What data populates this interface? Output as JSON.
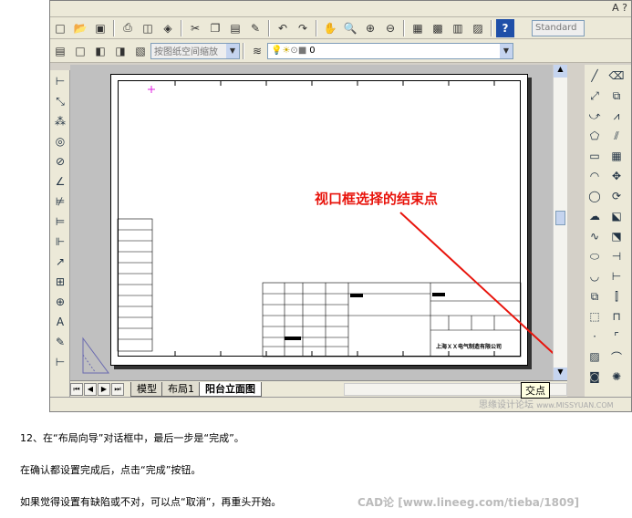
{
  "toolbar": {
    "layer_combo": "按图纸空间缩放",
    "layer_value": "0",
    "style_combo": "Standard"
  },
  "annotation": {
    "text": "视口框选择的结束点"
  },
  "tabs": [
    "模型",
    "布局1",
    "阳台立面图"
  ],
  "status": {
    "tooltip": "交点"
  },
  "watermark": {
    "site": "思缘设计论坛",
    "url": "www.MISSYUAN.COM",
    "cad": "CAD论",
    "cad_url": "[www.lineeg.com/tieba/1809]"
  },
  "captions": [
    "12、在“布局向导”对话框中，最后一步是“完成”。",
    "在确认都设置完成后，点击“完成”按钮。",
    "如果觉得设置有缺陷或不对，可以点“取消”，再重头开始。"
  ],
  "titleblock": {
    "company": "上海ＸＸ电气制造有限公司"
  },
  "colors": {
    "annotation": "#e8140c",
    "marker": "#e020e0"
  }
}
